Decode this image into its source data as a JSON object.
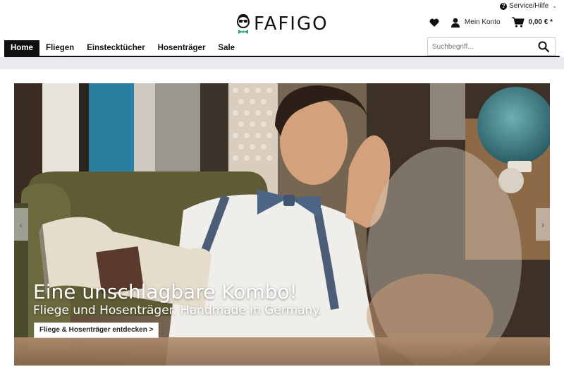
{
  "header": {
    "service_label": "Service/Hilfe",
    "logo_text": "FAFIGO",
    "account_label": "Mein Konto",
    "cart_total": "0,00 € *"
  },
  "nav": {
    "items": [
      {
        "label": "Home",
        "active": true
      },
      {
        "label": "Fliegen",
        "active": false
      },
      {
        "label": "Einstecktücher",
        "active": false
      },
      {
        "label": "Hosenträger",
        "active": false
      },
      {
        "label": "Sale",
        "active": false
      }
    ]
  },
  "search": {
    "placeholder": "Suchbegriff..."
  },
  "hero": {
    "headline": "Eine unschlagbare Kombo!",
    "subline": "Fliege und Hosenträger. Handmade in Germany.",
    "cta_label": "Fliege & Hosenträger entdecken >",
    "prev_icon": "chevron-left-icon",
    "next_icon": "chevron-right-icon"
  },
  "icons": {
    "service": "question-circle-icon",
    "wishlist": "heart-icon",
    "account": "user-icon",
    "cart": "cart-icon",
    "search": "search-icon"
  },
  "colors": {
    "nav_active_bg": "#111111",
    "band": "#e9eaee",
    "logo_bowtie": "#2fa37a"
  }
}
